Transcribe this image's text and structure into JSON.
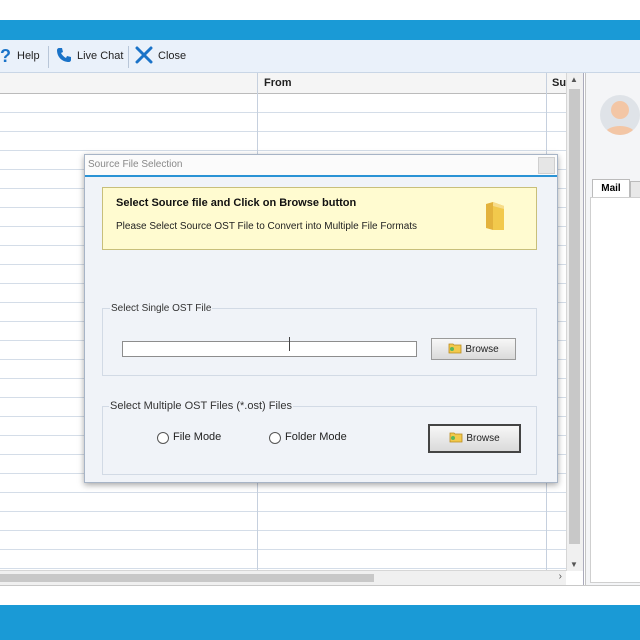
{
  "toolbar": {
    "help_label": "Help",
    "live_chat_label": "Live Chat",
    "close_label": "Close"
  },
  "grid": {
    "columns": [
      "From",
      "Su"
    ]
  },
  "right_pane": {
    "tab_mail": "Mail"
  },
  "dialog": {
    "title": "Source File Selection",
    "banner_heading": "Select Source file and Click on Browse button",
    "banner_text": "Please Select Source OST File to Convert into Multiple File Formats",
    "single_group_label": "Select Single OST File",
    "single_path_value": "",
    "browse_label": "Browse",
    "multi_group_label": "Select Multiple OST Files (*.ost) Files",
    "file_mode_label": "File Mode",
    "folder_mode_label": "Folder Mode",
    "browse2_label": "Browse"
  },
  "colors": {
    "accent_blue": "#1a9ad6",
    "banner_yellow": "#fffbd0",
    "folder_yellow": "#f2c94c"
  },
  "icons": {
    "help": "question-icon",
    "live_chat": "phone-icon",
    "close": "close-x-icon",
    "banner": "folder-icon",
    "browse": "folder-icon",
    "avatar": "user-avatar-icon"
  }
}
